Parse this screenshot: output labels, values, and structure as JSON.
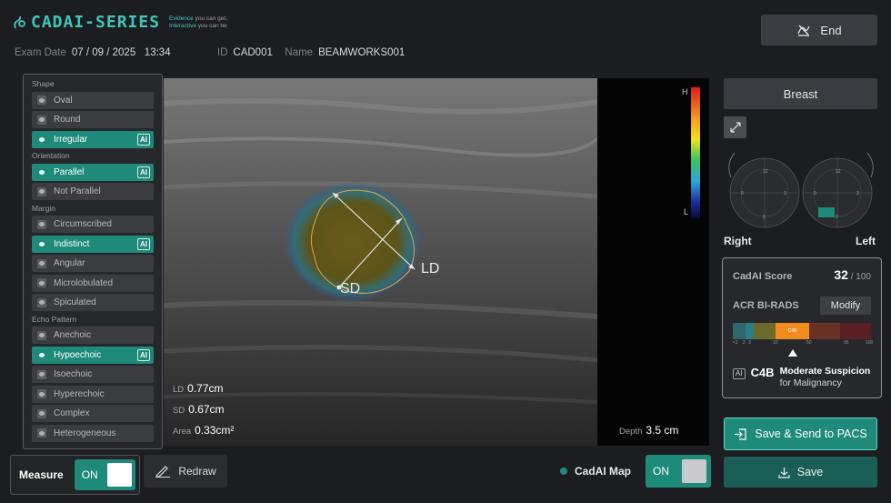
{
  "app": {
    "brand": "CADAI-SERIES",
    "tagline_line1_accent": "Evidence",
    "tagline_line1_rest": " you can get,",
    "tagline_line2_accent": "Interactive",
    "tagline_line2_rest": " you can be"
  },
  "exam": {
    "date_label": "Exam Date",
    "date_value": "07 / 09 / 2025   13:34",
    "id_label": "ID",
    "id_value": "CAD001",
    "name_label": "Name",
    "name_value": "BEAMWORKS001"
  },
  "header": {
    "end_label": "End"
  },
  "lexicon": {
    "sections": [
      {
        "title": "Shape",
        "options": [
          {
            "label": "Oval",
            "selected": false,
            "ai": false
          },
          {
            "label": "Round",
            "selected": false,
            "ai": false
          },
          {
            "label": "Irregular",
            "selected": true,
            "ai": true
          }
        ]
      },
      {
        "title": "Orientation",
        "options": [
          {
            "label": "Parallel",
            "selected": true,
            "ai": true
          },
          {
            "label": "Not Parallel",
            "selected": false,
            "ai": false
          }
        ]
      },
      {
        "title": "Margin",
        "options": [
          {
            "label": "Circumscribed",
            "selected": false,
            "ai": false
          },
          {
            "label": "Indistinct",
            "selected": true,
            "ai": true
          },
          {
            "label": "Angular",
            "selected": false,
            "ai": false
          },
          {
            "label": "Microlobulated",
            "selected": false,
            "ai": false
          },
          {
            "label": "Spiculated",
            "selected": false,
            "ai": false
          }
        ]
      },
      {
        "title": "Echo Pattern",
        "options": [
          {
            "label": "Anechoic",
            "selected": false,
            "ai": false
          },
          {
            "label": "Hypoechoic",
            "selected": true,
            "ai": true
          },
          {
            "label": "Isoechoic",
            "selected": false,
            "ai": false
          },
          {
            "label": "Hyperechoic",
            "selected": false,
            "ai": false
          },
          {
            "label": "Complex",
            "selected": false,
            "ai": false
          },
          {
            "label": "Heterogeneous",
            "selected": false,
            "ai": false
          }
        ]
      }
    ],
    "ai_badge": "AI"
  },
  "viewer": {
    "ld_tag": "LD",
    "sd_tag": "SD",
    "scale_high": "H",
    "scale_low": "L",
    "ld_label": "LD",
    "ld_value": "0.77cm",
    "sd_label": "SD",
    "sd_value": "0.67cm",
    "area_label": "Area",
    "area_value": "0.33cm²",
    "depth_label": "Depth",
    "depth_value": "3.5 cm"
  },
  "controls": {
    "measure_label": "Measure",
    "measure_state": "ON",
    "redraw_label": "Redraw",
    "cadai_map_label": "CadAI Map",
    "cadai_map_state": "ON"
  },
  "right": {
    "region_label": "Breast",
    "right_label": "Right",
    "left_label": "Left",
    "clock_labels": [
      "12",
      "3",
      "6",
      "9"
    ],
    "score_label": "CadAI Score",
    "score_value": "32",
    "score_max": " / 100",
    "birads_label": "ACR BI-RADS",
    "modify_label": "Modify",
    "bar_selected": "C4B",
    "bar_ticks": [
      "<1",
      "2",
      "3",
      "10",
      "50",
      "95",
      "100"
    ],
    "result_ai": "AI",
    "result_category": "C4B",
    "result_title": "Moderate Suspicion",
    "result_sub": "for Malignancy",
    "save_pacs_label": "Save & Send to PACS",
    "save_label": "Save"
  },
  "colors": {
    "accent": "#1e8a7a",
    "accent_light": "#3ec7b7",
    "selected_category": "#f28c1f",
    "background": "#1c1d21"
  }
}
